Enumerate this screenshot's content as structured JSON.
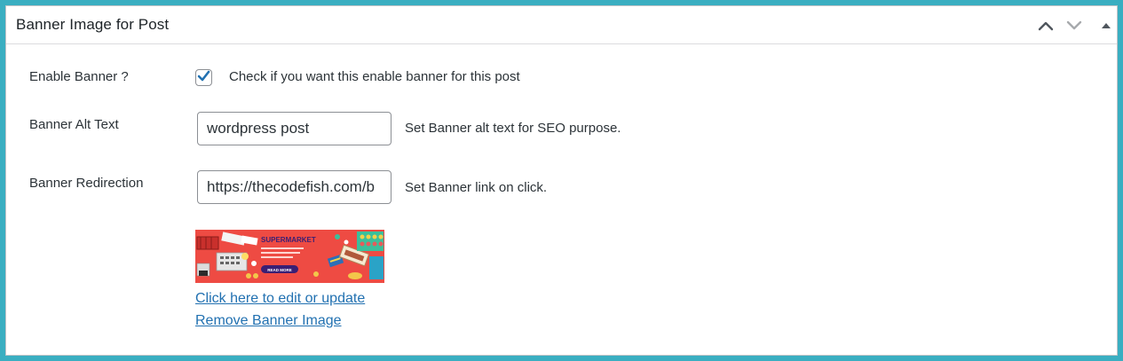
{
  "panel": {
    "title": "Banner Image for Post",
    "controls": [
      "chevron-up-icon",
      "chevron-down-icon",
      "triangle-up-icon"
    ]
  },
  "enable_banner": {
    "label": "Enable Banner ?",
    "checked": true,
    "description": "Check if you want this enable banner for this post"
  },
  "alt_text": {
    "label": "Banner Alt Text",
    "value": "wordpress post",
    "description": "Set Banner alt text for SEO purpose."
  },
  "redirection": {
    "label": "Banner Redirection",
    "value": "https://thecodefish.com/b",
    "description": "Set Banner link on click."
  },
  "banner_image": {
    "heading": "SUPERMARKET",
    "button": "READ MORE",
    "background_color": "#ee4b43"
  },
  "links": {
    "edit": "Click here to edit or update",
    "remove": "Remove Banner Image"
  },
  "colors": {
    "frame": "#3aaec1",
    "link": "#2271b1",
    "checkmark": "#2271b1"
  }
}
